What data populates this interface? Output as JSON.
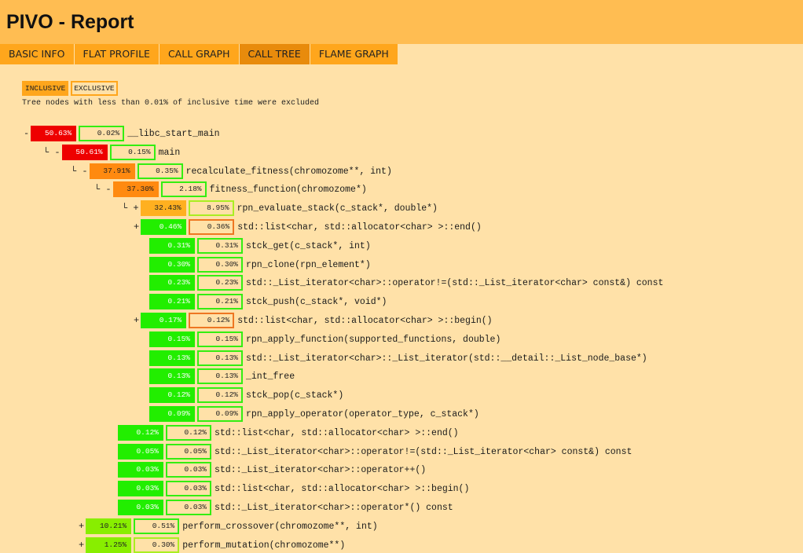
{
  "app": {
    "title": "PIVO - Report"
  },
  "tabs": [
    {
      "label": "BASIC INFO",
      "active": false
    },
    {
      "label": "FLAT PROFILE",
      "active": false
    },
    {
      "label": "CALL GRAPH",
      "active": false
    },
    {
      "label": "CALL TREE",
      "active": true
    },
    {
      "label": "FLAME GRAPH",
      "active": false
    }
  ],
  "toggles": {
    "inclusive": "INCLUSIVE",
    "exclusive": "EXCLUSIVE",
    "selected": "INCLUSIVE"
  },
  "note": "Tree nodes with less than 0.01% of inclusive time were excluded",
  "colors": {
    "header": "#ffbd52",
    "tabs": "#ffa61c",
    "tab_active": "#e88b0c",
    "background": "#ffe1a8",
    "red": "#ee0000",
    "orange": "#ff8a10",
    "light_orange": "#ffb020",
    "green": "#22ee00",
    "lime": "#88ee00",
    "exc_border_green": "#33ee11",
    "exc_border_lime": "#aaee22",
    "exc_border_orange": "#ee7722"
  },
  "tree": [
    {
      "prefix": "-",
      "inc": "50.63%",
      "exc": "0.02%",
      "name": "__libc_start_main",
      "color": "red",
      "exc_border": "green"
    },
    {
      "prefix": "└ -",
      "inc": "50.61%",
      "exc": "0.15%",
      "name": "main",
      "color": "red",
      "exc_border": "green"
    },
    {
      "prefix": "└ -",
      "inc": "37.91%",
      "exc": "0.35%",
      "name": "recalculate_fitness(chromozome**, int)",
      "color": "orange",
      "exc_border": "green"
    },
    {
      "prefix": "└ -",
      "inc": "37.30%",
      "exc": "2.18%",
      "name": "fitness_function(chromozome*)",
      "color": "orange",
      "exc_border": "green"
    },
    {
      "prefix": "└ +",
      "inc": "32.43%",
      "exc": "8.95%",
      "name": "rpn_evaluate_stack(c_stack*, double*)",
      "color": "light_orange",
      "exc_border": "lime"
    },
    {
      "prefix": "+",
      "inc": "0.46%",
      "exc": "0.36%",
      "name": "std::list<char, std::allocator<char> >::end()",
      "color": "green",
      "exc_border": "orange"
    },
    {
      "prefix": "",
      "inc": "0.31%",
      "exc": "0.31%",
      "name": "stck_get(c_stack*, int)",
      "color": "green",
      "exc_border": "green"
    },
    {
      "prefix": "",
      "inc": "0.30%",
      "exc": "0.30%",
      "name": "rpn_clone(rpn_element*)",
      "color": "green",
      "exc_border": "green"
    },
    {
      "prefix": "",
      "inc": "0.23%",
      "exc": "0.23%",
      "name": "std::_List_iterator<char>::operator!=(std::_List_iterator<char> const&) const",
      "color": "green",
      "exc_border": "green"
    },
    {
      "prefix": "",
      "inc": "0.21%",
      "exc": "0.21%",
      "name": "stck_push(c_stack*, void*)",
      "color": "green",
      "exc_border": "green"
    },
    {
      "prefix": "+",
      "inc": "0.17%",
      "exc": "0.12%",
      "name": "std::list<char, std::allocator<char> >::begin()",
      "color": "green",
      "exc_border": "orange"
    },
    {
      "prefix": "",
      "inc": "0.15%",
      "exc": "0.15%",
      "name": "rpn_apply_function(supported_functions, double)",
      "color": "green",
      "exc_border": "green"
    },
    {
      "prefix": "",
      "inc": "0.13%",
      "exc": "0.13%",
      "name": "std::_List_iterator<char>::_List_iterator(std::__detail::_List_node_base*)",
      "color": "green",
      "exc_border": "green"
    },
    {
      "prefix": "",
      "inc": "0.13%",
      "exc": "0.13%",
      "name": "_int_free",
      "color": "green",
      "exc_border": "green"
    },
    {
      "prefix": "",
      "inc": "0.12%",
      "exc": "0.12%",
      "name": "stck_pop(c_stack*)",
      "color": "green",
      "exc_border": "green"
    },
    {
      "prefix": "",
      "inc": "0.09%",
      "exc": "0.09%",
      "name": "rpn_apply_operator(operator_type, c_stack*)",
      "color": "green",
      "exc_border": "green"
    },
    {
      "prefix": "",
      "inc": "0.12%",
      "exc": "0.12%",
      "name": "std::list<char, std::allocator<char> >::end()",
      "color": "green",
      "exc_border": "green"
    },
    {
      "prefix": "",
      "inc": "0.05%",
      "exc": "0.05%",
      "name": "std::_List_iterator<char>::operator!=(std::_List_iterator<char> const&) const",
      "color": "green",
      "exc_border": "green"
    },
    {
      "prefix": "",
      "inc": "0.03%",
      "exc": "0.03%",
      "name": "std::_List_iterator<char>::operator++()",
      "color": "green",
      "exc_border": "green"
    },
    {
      "prefix": "",
      "inc": "0.03%",
      "exc": "0.03%",
      "name": "std::list<char, std::allocator<char> >::begin()",
      "color": "green",
      "exc_border": "green"
    },
    {
      "prefix": "",
      "inc": "0.03%",
      "exc": "0.03%",
      "name": "std::_List_iterator<char>::operator*() const",
      "color": "green",
      "exc_border": "green"
    },
    {
      "prefix": "+",
      "inc": "10.21%",
      "exc": "0.51%",
      "name": "perform_crossover(chromozome**, int)",
      "color": "lime",
      "exc_border": "green"
    },
    {
      "prefix": "+",
      "inc": "1.25%",
      "exc": "0.30%",
      "name": "perform_mutation(chromozome**)",
      "color": "lime",
      "exc_border": "lime"
    }
  ]
}
